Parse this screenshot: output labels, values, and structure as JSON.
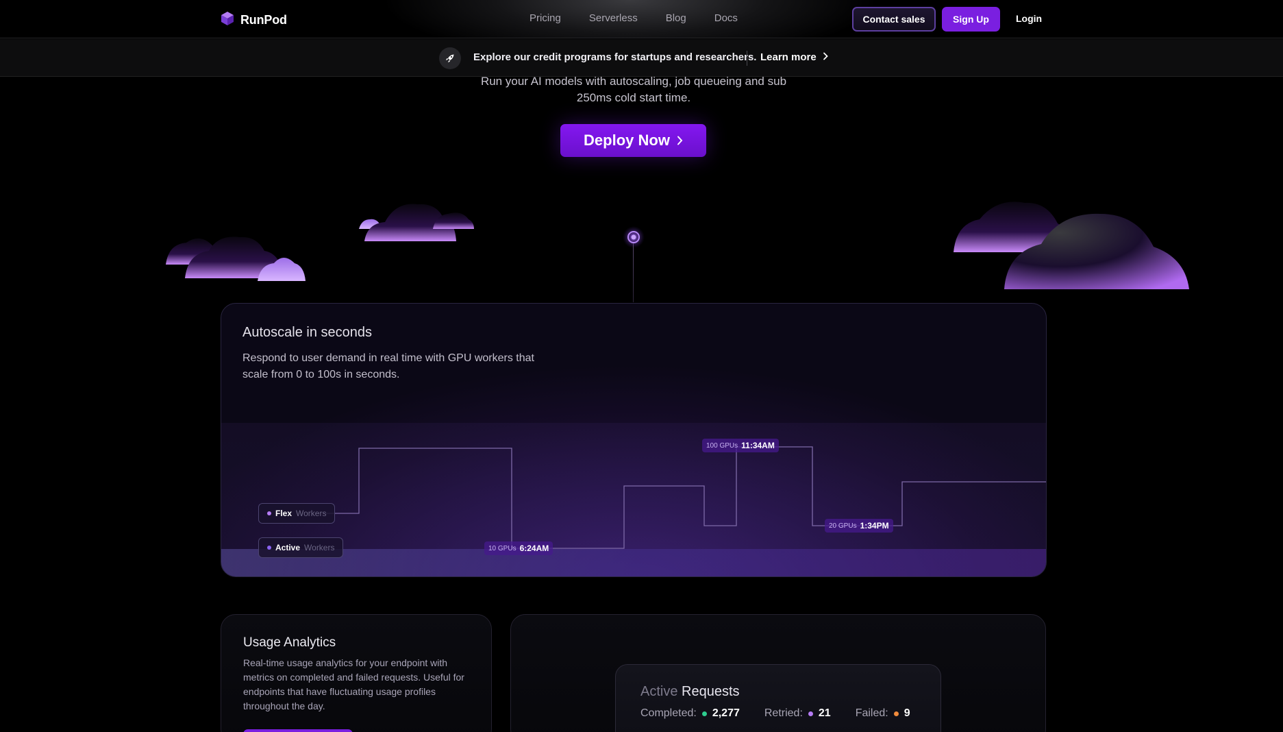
{
  "nav": {
    "brand": "RunPod",
    "links": [
      "Pricing",
      "Serverless",
      "Blog",
      "Docs"
    ],
    "contact_label": "Contact sales",
    "signup_label": "Sign Up",
    "login_label": "Login"
  },
  "banner": {
    "text": "Explore our credit programs for startups and researchers.",
    "link_label": "Learn more"
  },
  "hero": {
    "subtitle": "Run your AI models with autoscaling, job queueing and sub 250ms cold start time.",
    "cta_label": "Deploy Now"
  },
  "autoscale": {
    "title": "Autoscale in seconds",
    "description": "Respond to user demand in real time with GPU workers that scale from 0 to 100s in seconds.",
    "legend": [
      {
        "name": "Flex",
        "suffix": "Workers",
        "color": "#b57cf5"
      },
      {
        "name": "Active",
        "suffix": "Workers",
        "color": "#8a63f0"
      }
    ],
    "tags": [
      {
        "gpus": "10 GPUs",
        "time": "6:24AM"
      },
      {
        "gpus": "100 GPUs",
        "time": "11:34AM"
      },
      {
        "gpus": "20 GPUs",
        "time": "1:34PM"
      }
    ]
  },
  "usage": {
    "title": "Usage Analytics",
    "description": "Real-time usage analytics for your endpoint with metrics on completed and failed requests. Useful for endpoints that have fluctuating usage profiles throughout the day."
  },
  "requests": {
    "title_dim": "Active",
    "title_main": "Requests",
    "stats": [
      {
        "label": "Completed:",
        "value": "2,277",
        "color": "#2ecc8f"
      },
      {
        "label": "Retried:",
        "value": "21",
        "color": "#b57cf5"
      },
      {
        "label": "Failed:",
        "value": "9",
        "color": "#f08a3c"
      }
    ]
  },
  "icons": {
    "logo": "cube-logo-icon",
    "banner": "rocket-icon",
    "chevron": "chevron-right-icon"
  },
  "colors": {
    "accent": "#7a1fe0",
    "background": "#000000"
  }
}
